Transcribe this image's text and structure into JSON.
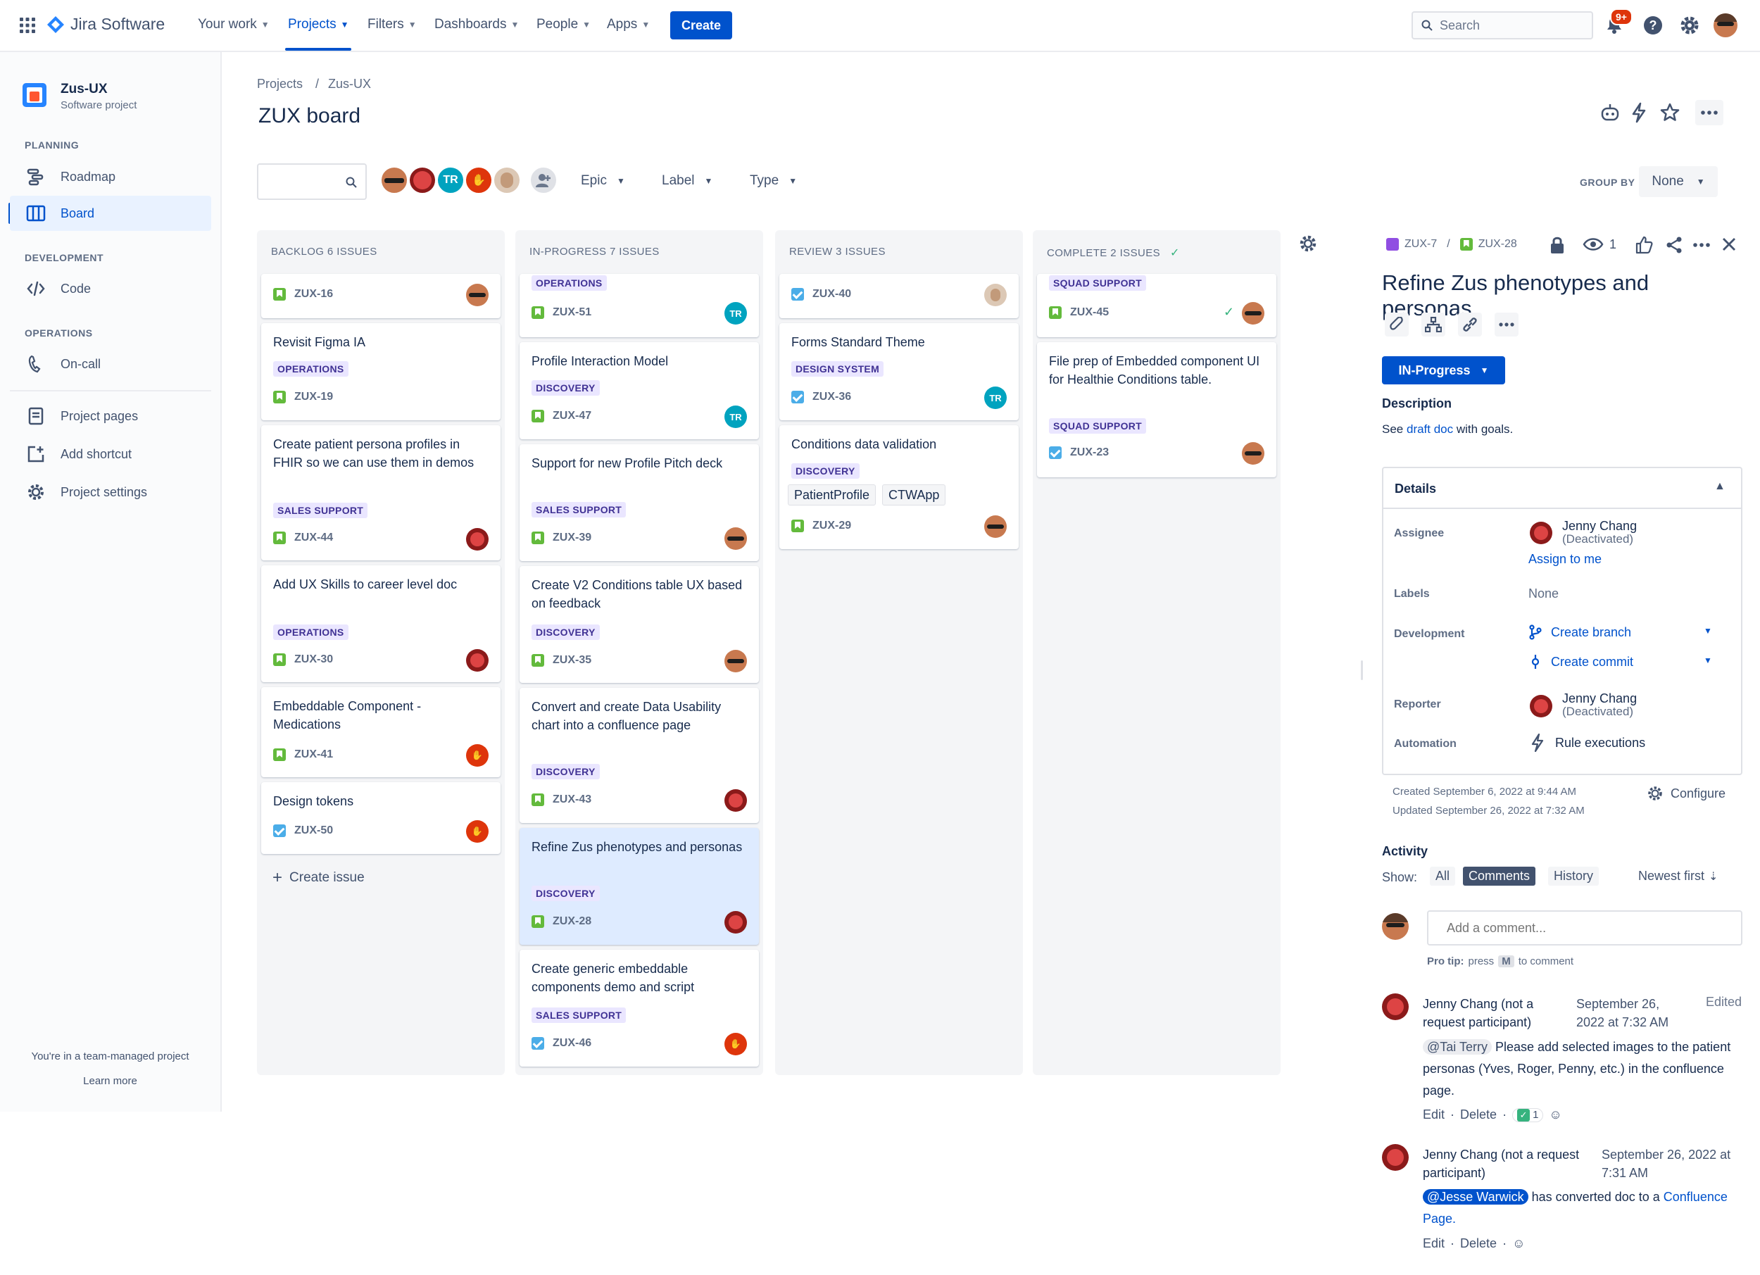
{
  "colors": {
    "brand": "#0052cc",
    "story": "#63ba3c",
    "task": "#4bade8",
    "notification": "#de350b"
  },
  "topnav": {
    "logo": "Jira Software",
    "items": [
      {
        "label": "Your work"
      },
      {
        "label": "Projects"
      },
      {
        "label": "Filters"
      },
      {
        "label": "Dashboards"
      },
      {
        "label": "People"
      },
      {
        "label": "Apps"
      }
    ],
    "create": "Create",
    "search_placeholder": "Search",
    "notif_badge": "9+"
  },
  "sidebar": {
    "project_name": "Zus-UX",
    "project_type": "Software project",
    "planning_head": "PLANNING",
    "roadmap": "Roadmap",
    "board": "Board",
    "development_head": "DEVELOPMENT",
    "code": "Code",
    "operations_head": "OPERATIONS",
    "oncall": "On-call",
    "project_pages": "Project pages",
    "add_shortcut": "Add shortcut",
    "project_settings": "Project settings",
    "footer_text": "You're in a team-managed project",
    "learn_more": "Learn more"
  },
  "board": {
    "breadcrumb": [
      "Projects",
      "/",
      "Zus-UX"
    ],
    "title": "ZUX board",
    "avatar_initials": "TR",
    "filters": {
      "epic": "Epic",
      "label": "Label",
      "type": "Type"
    },
    "group_by_label": "GROUP BY",
    "group_by_value": "None",
    "columns": [
      {
        "heading": "BACKLOG 6 ISSUES",
        "cards": [
          {
            "key": "ZUX-16"
          },
          {
            "title": "Revisit Figma IA",
            "label": "OPERATIONS",
            "key": "ZUX-19"
          },
          {
            "title": "Create patient persona profiles in FHIR so we can use them in demos",
            "label": "SALES SUPPORT",
            "key": "ZUX-44"
          },
          {
            "title": "Add UX Skills to career level doc",
            "label": "OPERATIONS",
            "key": "ZUX-30"
          },
          {
            "title": "Embeddable Component - Medications",
            "key": "ZUX-41"
          },
          {
            "title": "Design tokens",
            "key": "ZUX-50"
          }
        ],
        "create_issue": "Create issue"
      },
      {
        "heading": "IN-PROGRESS 7 ISSUES",
        "cards": [
          {
            "label": "OPERATIONS",
            "key": "ZUX-51"
          },
          {
            "title": "Profile Interaction Model",
            "label": "DISCOVERY",
            "key": "ZUX-47"
          },
          {
            "title": "Support for new Profile Pitch deck",
            "label": "SALES SUPPORT",
            "key": "ZUX-39"
          },
          {
            "title": "Create V2 Conditions table UX based on feedback",
            "label": "DISCOVERY",
            "key": "ZUX-35"
          },
          {
            "title": "Convert and create Data Usability chart into a confluence page",
            "label": "DISCOVERY",
            "key": "ZUX-43"
          },
          {
            "title": "Refine Zus phenotypes and personas",
            "label": "DISCOVERY",
            "key": "ZUX-28"
          },
          {
            "title": "Create generic embeddable components demo and script",
            "label": "SALES SUPPORT",
            "key": "ZUX-46"
          }
        ]
      },
      {
        "heading": "REVIEW 3 ISSUES",
        "cards": [
          {
            "key": "ZUX-40"
          },
          {
            "title": "Forms Standard Theme",
            "label": "DESIGN SYSTEM",
            "key": "ZUX-36"
          },
          {
            "title": "Conditions data validation",
            "label": "DISCOVERY",
            "tags": [
              "PatientProfile",
              "CTWApp"
            ],
            "key": "ZUX-29"
          }
        ]
      },
      {
        "heading": "COMPLETE 2 ISSUES",
        "cards": [
          {
            "label": "SQUAD SUPPORT",
            "key": "ZUX-45"
          },
          {
            "title": "File prep of Embedded component UI for Healthie Conditions table.",
            "label": "SQUAD SUPPORT",
            "key": "ZUX-23"
          }
        ]
      }
    ]
  },
  "detail": {
    "parent_key": "ZUX-7",
    "sep": "/",
    "key": "ZUX-28",
    "watch_count": "1",
    "title": "Refine Zus phenotypes and personas",
    "status": "IN-Progress",
    "description_head": "Description",
    "description_pre": "See",
    "description_link": "draft doc",
    "description_post": "with goals.",
    "details_head": "Details",
    "assignee_label": "Assignee",
    "assignee_name": "Jenny Chang",
    "assignee_sub": "(Deactivated)",
    "assign_to_me": "Assign to me",
    "labels_label": "Labels",
    "labels_value": "None",
    "development_label": "Development",
    "create_branch": "Create branch",
    "create_commit": "Create commit",
    "reporter_label": "Reporter",
    "reporter_name": "Jenny Chang",
    "reporter_sub": "(Deactivated)",
    "automation_label": "Automation",
    "rule_executions": "Rule executions",
    "created": "Created September 6, 2022 at 9:44 AM",
    "updated": "Updated September 26, 2022 at 7:32 AM",
    "configure": "Configure",
    "activity_head": "Activity",
    "show_label": "Show:",
    "show_all": "All",
    "show_comments": "Comments",
    "show_history": "History",
    "newest_first": "Newest first",
    "comment_placeholder": "Add a comment...",
    "protip_bold": "Pro tip:",
    "protip_pre": "press",
    "protip_key": "M",
    "protip_post": "to comment",
    "comments": [
      {
        "author": "Jenny Chang (not a request participant)",
        "date": "September 26, 2022 at 7:32 AM",
        "edited": "Edited",
        "mention": "@Tai Terry",
        "body": "Please add selected images to the patient personas (Yves, Roger, Penny, etc.) in the confluence page.",
        "edit": "Edit",
        "delete": "Delete",
        "dot": "·",
        "reaction_count": "1"
      },
      {
        "author": "Jenny Chang (not a request participant)",
        "date": "September 26, 2022 at 7:31 AM",
        "mention": "@Jesse Warwick",
        "body_pre": "has converted doc to a",
        "body_link": "Confluence Page.",
        "edit": "Edit",
        "delete": "Delete",
        "dot": "·"
      }
    ]
  }
}
